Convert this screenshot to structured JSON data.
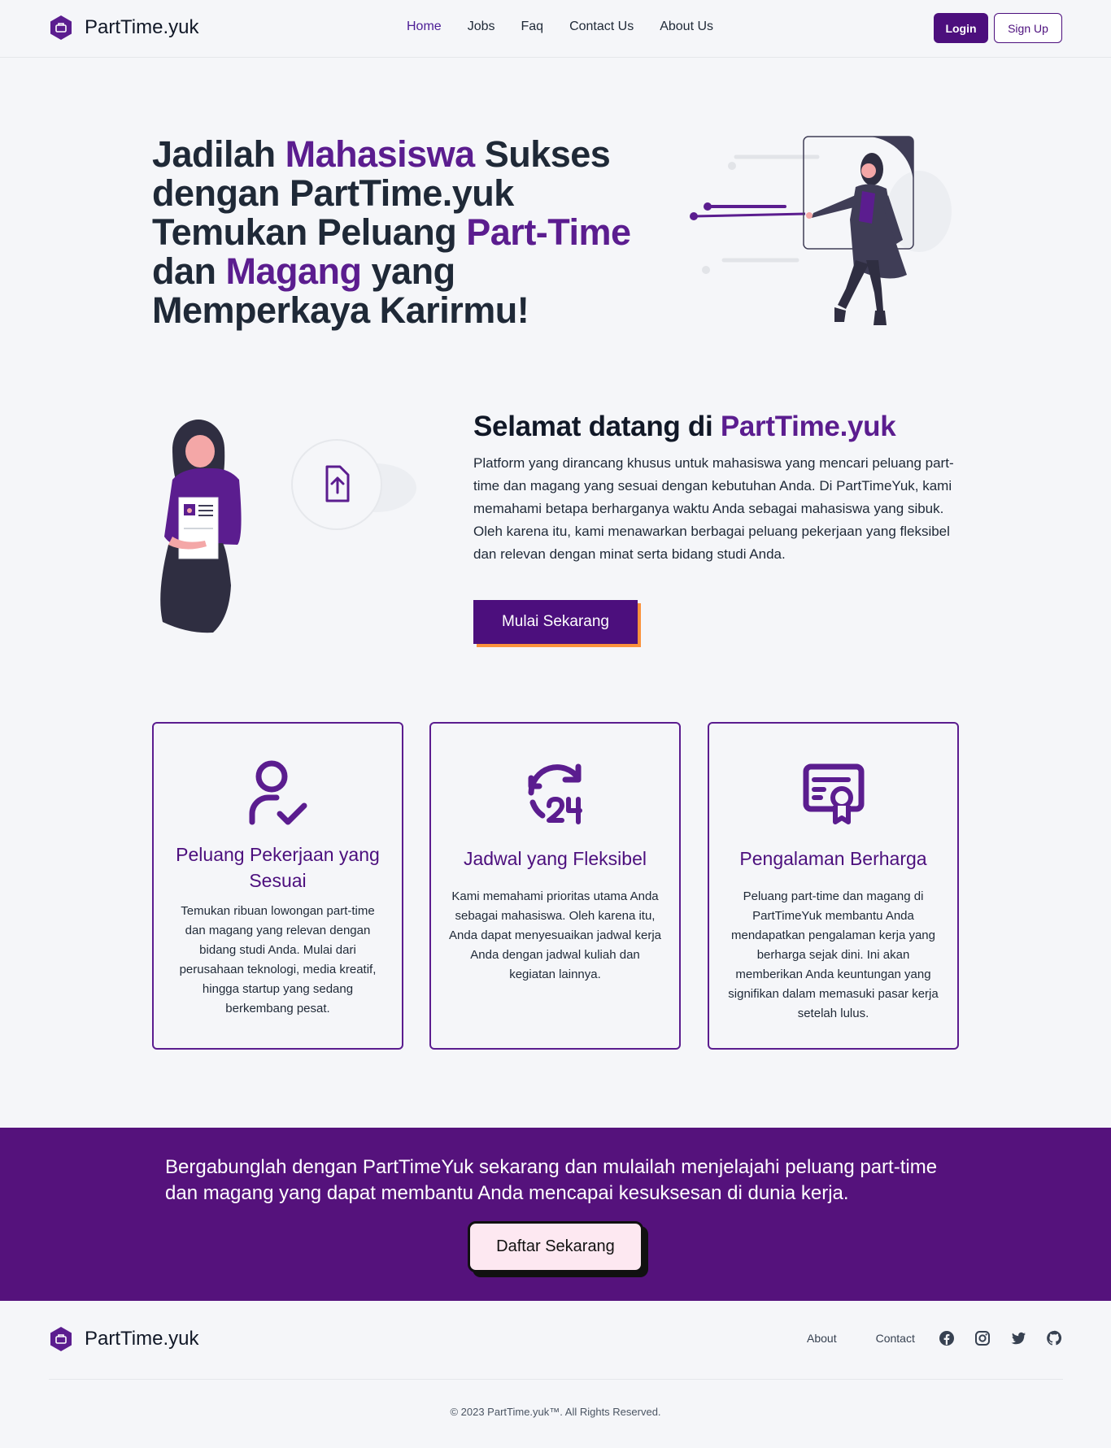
{
  "header": {
    "brand": "PartTime.yuk",
    "nav": [
      {
        "label": "Home",
        "active": true
      },
      {
        "label": "Jobs"
      },
      {
        "label": "Faq"
      },
      {
        "label": "Contact Us"
      },
      {
        "label": "About Us"
      }
    ],
    "login_label": "Login",
    "signup_label": "Sign Up"
  },
  "hero": {
    "line1_a": "Jadilah ",
    "line1_accent": "Mahasiswa",
    "line1_b": " Sukses",
    "line2": "dengan PartTime.yuk",
    "line3_a": "Temukan Peluang ",
    "line3_accent": "Part-Time",
    "line4_a": "dan ",
    "line4_accent": "Magang",
    "line4_b": " yang",
    "line5": "Memperkaya Karirmu!"
  },
  "welcome": {
    "title_a": "Selamat datang di ",
    "title_accent": "PartTime.yuk",
    "text": "Platform yang dirancang khusus untuk mahasiswa yang mencari peluang part-time dan magang yang sesuai dengan kebutuhan Anda. Di PartTimeYuk, kami memahami betapa berharganya waktu Anda sebagai mahasiswa yang sibuk. Oleh karena itu, kami menawarkan berbagai peluang pekerjaan yang fleksibel dan relevan dengan minat serta bidang studi Anda.",
    "button_label": "Mulai Sekarang"
  },
  "cards": [
    {
      "icon": "user-check-icon",
      "title": "Peluang Pekerjaan yang Sesuai",
      "text": "Temukan ribuan lowongan part-time dan magang yang relevan dengan bidang studi Anda. Mulai dari perusahaan teknologi, media kreatif, hingga startup yang sedang berkembang pesat."
    },
    {
      "icon": "clock-24-icon",
      "title": "Jadwal yang Fleksibel",
      "text": "Kami memahami prioritas utama Anda sebagai mahasiswa. Oleh karena itu, Anda dapat menyesuaikan jadwal kerja Anda dengan jadwal kuliah dan kegiatan lainnya."
    },
    {
      "icon": "certificate-icon",
      "title": "Pengalaman Berharga",
      "text": "Peluang part-time dan magang di PartTimeYuk membantu Anda mendapatkan pengalaman kerja yang berharga sejak dini. Ini akan memberikan Anda keuntungan yang signifikan dalam memasuki pasar kerja setelah lulus."
    }
  ],
  "cta": {
    "text": "Bergabunglah dengan PartTimeYuk sekarang dan mulailah menjelajahi peluang part-time dan magang yang dapat membantu Anda mencapai kesuksesan di dunia kerja.",
    "button_label": "Daftar Sekarang"
  },
  "footer": {
    "brand": "PartTime.yuk",
    "links": [
      "About",
      "Contact"
    ],
    "socials": [
      "facebook-icon",
      "instagram-icon",
      "twitter-icon",
      "github-icon"
    ],
    "copyright": "© 2023 PartTime.yuk™. All Rights Reserved."
  },
  "colors": {
    "primary": "#4c0f7d",
    "accent_text": "#5b1d8f",
    "cta_band": "#55127c",
    "button_shadow": "#fb923c",
    "join_button_bg": "#fde8f1"
  }
}
